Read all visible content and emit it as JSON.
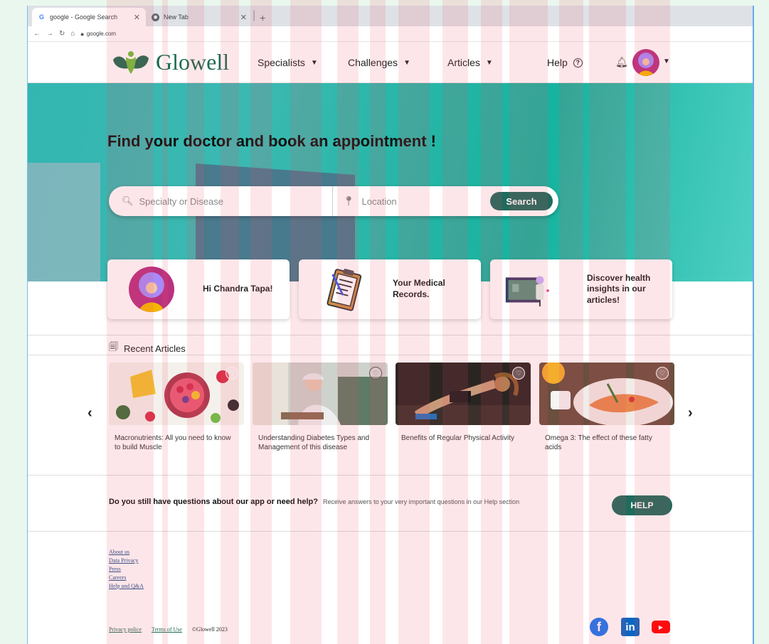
{
  "browser": {
    "tabs": [
      {
        "icon": "google-icon",
        "title": "google - Google Search"
      },
      {
        "icon": "new-tab-icon",
        "title": "New Tab"
      }
    ],
    "new_tab_label": "+",
    "url": "google.com"
  },
  "header": {
    "logo_text": "Glowell",
    "nav": {
      "specialists": "Specialists",
      "challenges": "Challenges",
      "articles": "Articles",
      "help": "Help"
    }
  },
  "hero": {
    "title": "Find your doctor and book an appointment !",
    "search_placeholder": "Specialty or Disease",
    "location_placeholder": "Location",
    "search_button": "Search"
  },
  "cards": {
    "greeting": "Hi Chandra Tapa!",
    "records": "Your Medical Records.",
    "insights": "Discover health insights in our articles!"
  },
  "articles": {
    "section_title": "Recent Articles",
    "items": [
      {
        "title": "Macronutrients: All you need to know to build Muscle"
      },
      {
        "title": "Understanding Diabetes Types and Management of this disease"
      },
      {
        "title": "Benefits of  Regular Physical Activity"
      },
      {
        "title": "Omega 3: The effect  of these fatty acids"
      }
    ]
  },
  "help": {
    "question": "Do you still have questions about our app or need help?",
    "subtext": "Receive answers to your very important questions in our Help section",
    "button": "HELP"
  },
  "footer": {
    "links": [
      "About us",
      "Data Privacy",
      "Press",
      "Careers",
      "Help and Q&A"
    ],
    "privacy": "Privacy police",
    "terms": "Terms of Use",
    "copyright": "©Glowell  2023"
  },
  "colors": {
    "brand_green": "#1f6b5c",
    "hero_teal": "#16b39e",
    "avatar_magenta": "#b83280"
  }
}
